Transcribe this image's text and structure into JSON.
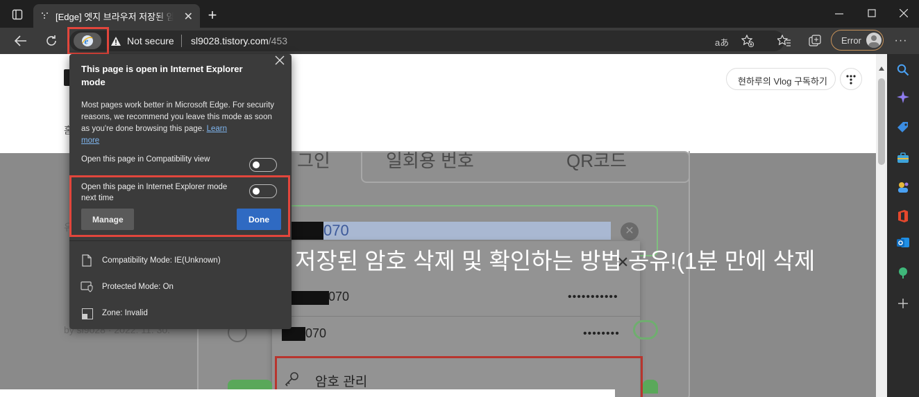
{
  "tab": {
    "title": "[Edge] 엣지 브라우저 저장된 암호"
  },
  "address": {
    "security_label": "Not secure",
    "url_host": "sl9028.tistory.com",
    "url_path": "/453",
    "reader_label": "aあ",
    "error_label": "Error"
  },
  "popup": {
    "title": "This page is open in Internet Explorer mode",
    "body": "Most pages work better in Microsoft Edge. For security reasons, we recommend you leave this mode as soon as you're done browsing this page.",
    "learn_more_1": "Learn",
    "learn_more_2": "more",
    "compat_view_label": "Open this page in Compatibility view",
    "ie_next_time_label": "Open this page in Internet Explorer mode next time",
    "manage_label": "Manage",
    "done_label": "Done",
    "info": [
      {
        "label": "Compatibility Mode: IE(Unknown)"
      },
      {
        "label": "Protected Mode: On"
      },
      {
        "label": "Zone: Invalid"
      }
    ]
  },
  "page": {
    "subscribe_label": "현하루의 Vlog 구독하기",
    "headline": "저장된 암호 삭제 및 확인하는 방법 공유!(1분 만에 삭제",
    "tab_login_fragment": "그인",
    "tab_onetime": "일회용 번호",
    "tab_qr": "QR코드",
    "input_value": "070",
    "saved_rows": [
      {
        "id": "070",
        "pw": "•••••••••••"
      },
      {
        "id": "070",
        "pw": "••••••••"
      }
    ],
    "manage_pw_label": "암호 관리",
    "byline": "by sl9028 · 2022. 11. 30.",
    "category_fragment": "유",
    "home_fragment": "홈"
  },
  "colors": {
    "accent": "#2f6ac2",
    "highlight_red": "#e2463c",
    "error_border": "#c8935a"
  }
}
